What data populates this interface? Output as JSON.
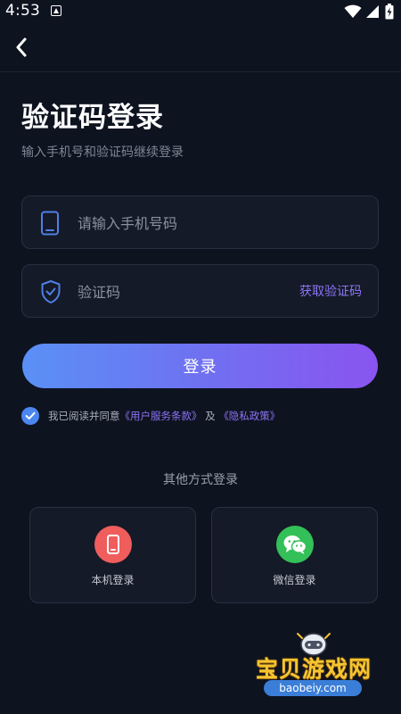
{
  "status_bar": {
    "time": "4:53"
  },
  "header": {
    "back_icon": "chevron-left-icon"
  },
  "title": "验证码登录",
  "subtitle": "输入手机号和验证码继续登录",
  "phone_field": {
    "placeholder": "请输入手机号码",
    "value": "",
    "icon": "phone-icon"
  },
  "code_field": {
    "placeholder": "验证码",
    "value": "",
    "icon": "shield-icon",
    "get_code_label": "获取验证码"
  },
  "login_button": {
    "label": "登录"
  },
  "agreement": {
    "checked": true,
    "prefix": "我已阅读并同意",
    "terms_link": "《用户服务条款》",
    "joiner": "及",
    "privacy_link": "《隐私政策》"
  },
  "other_login": {
    "title": "其他方式登录",
    "options": [
      {
        "label": "本机登录",
        "icon": "mobile-phone-icon",
        "color": "#ef5d5d"
      },
      {
        "label": "微信登录",
        "icon": "wechat-icon",
        "color": "#34c058"
      }
    ]
  },
  "watermark": {
    "text": "宝贝游戏网",
    "url": "baobeiy.com"
  },
  "colors": {
    "background": "#0e1320",
    "accent": "#8b74f4",
    "gradient_start": "#5a90f6",
    "gradient_end": "#8a54f0"
  }
}
